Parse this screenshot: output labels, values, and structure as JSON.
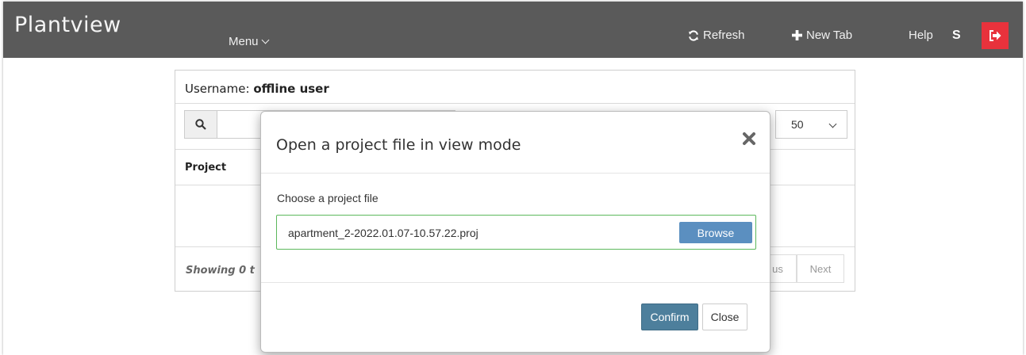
{
  "navbar": {
    "brand": "Plantview",
    "menu_label": "Menu",
    "refresh_label": "Refresh",
    "new_tab_label": "New Tab",
    "help_label": "Help",
    "user_initial": "S",
    "accent_logout": "#e8323c"
  },
  "panel": {
    "username_label": "Username:",
    "username_value": "offline user",
    "page_size": "50",
    "column_project": "Project",
    "showing_text": "Showing 0 t",
    "previous_label": "us",
    "next_label": "Next"
  },
  "modal": {
    "title": "Open a project file in view mode",
    "field_label": "Choose a project file",
    "file_value": "apartment_2-2022.01.07-10.57.22.proj",
    "browse_label": "Browse",
    "confirm_label": "Confirm",
    "close_label": "Close"
  },
  "icons": {
    "refresh": "refresh-icon",
    "new_tab": "plus-icon",
    "logout": "logout-icon",
    "search": "search-icon",
    "close": "close-icon"
  }
}
